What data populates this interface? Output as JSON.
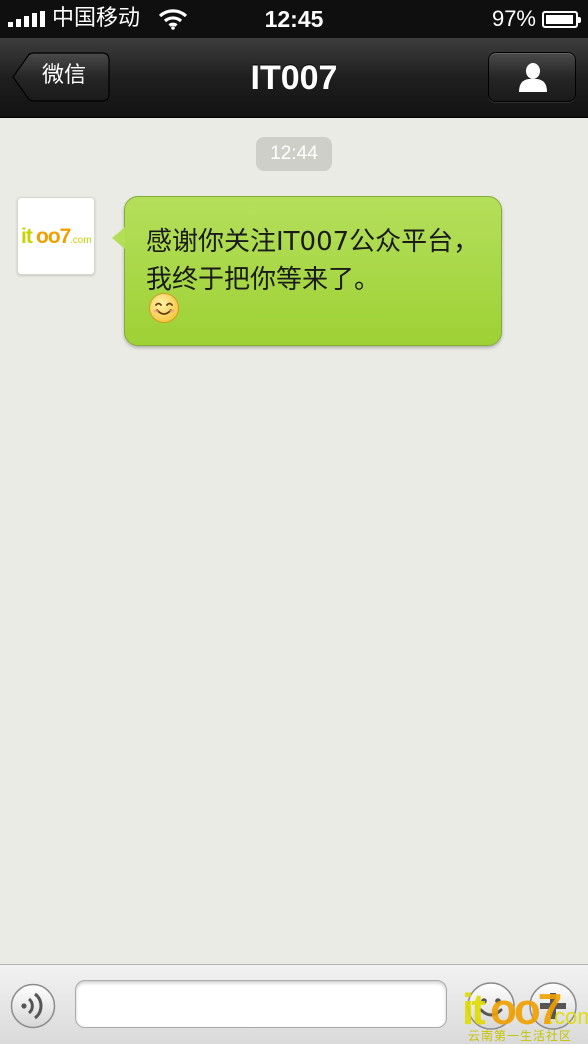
{
  "status_bar": {
    "carrier": "中国移动",
    "time": "12:45",
    "battery_percent_label": "97%",
    "battery_level": 0.97,
    "signal_bars": 5,
    "wifi_icon": "wifi-icon"
  },
  "nav_bar": {
    "back_label": "微信",
    "title": "IT007",
    "profile_icon": "person-icon"
  },
  "chat": {
    "timestamp": "12:44",
    "messages": [
      {
        "sender_avatar_logo_text": "it007.com",
        "text": "感谢你关注IT007公众平台，我终于把你等来了。",
        "emoji": "smile-emoji"
      }
    ]
  },
  "input_bar": {
    "voice_icon": "voice-icon",
    "input_value": "",
    "emoji_icon": "emoji-icon",
    "plus_icon": "plus-icon"
  },
  "watermark": {
    "logo_text": "it007.com",
    "caption": "云南第一生活社区"
  },
  "colors": {
    "chat_background": "#ebebe6",
    "bubble_green": "#a8d748",
    "nav_bar": "#1f1f1f"
  }
}
